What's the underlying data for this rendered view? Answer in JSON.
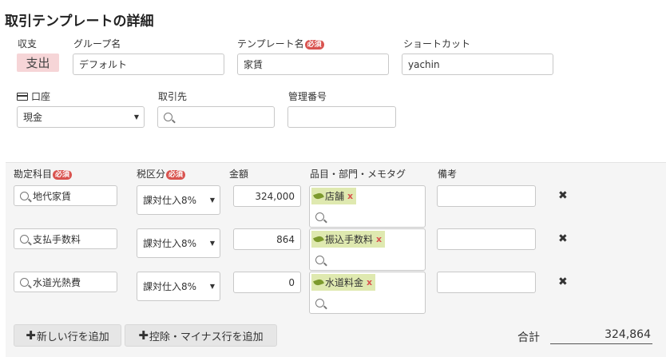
{
  "page": {
    "title": "取引テンプレートの詳細"
  },
  "labels": {
    "income_expense": "収支",
    "group_name": "グループ名",
    "template_name": "テンプレート名",
    "shortcut": "ショートカット",
    "account": "口座",
    "partner": "取引先",
    "management_number": "管理番号",
    "required": "必須"
  },
  "form": {
    "income_expense_value": "支出",
    "group_name_value": "デフォルト",
    "template_name_value": "家賃",
    "shortcut_value": "yachin",
    "account_value": "現金",
    "partner_value": "",
    "management_number_value": ""
  },
  "table": {
    "headers": {
      "account_item": "勘定科目",
      "tax_category": "税区分",
      "amount": "金額",
      "tags": "品目・部門・メモタグ",
      "remarks": "備考"
    },
    "rows": [
      {
        "account_item": "地代家賃",
        "tax": "課対仕入8%",
        "amount": "324,000",
        "tag": "店舗",
        "remarks": ""
      },
      {
        "account_item": "支払手数料",
        "tax": "課対仕入8%",
        "amount": "864",
        "tag": "振込手数料",
        "remarks": ""
      },
      {
        "account_item": "水道光熱費",
        "tax": "課対仕入8%",
        "amount": "0",
        "tag": "水道料金",
        "remarks": ""
      }
    ]
  },
  "buttons": {
    "add_row": "新しい行を追加",
    "add_deduction_row": "控除・マイナス行を追加"
  },
  "icons": {
    "remove_tag": "x",
    "delete_row": "✖",
    "plus": "✚",
    "caret": "▼"
  },
  "summary": {
    "total_label": "合計",
    "total_value": "324,864"
  },
  "colors": {
    "required_badge": "#d9534f",
    "expense_badge": "#f6d5d7",
    "tag_bg": "#dfe9b0"
  }
}
